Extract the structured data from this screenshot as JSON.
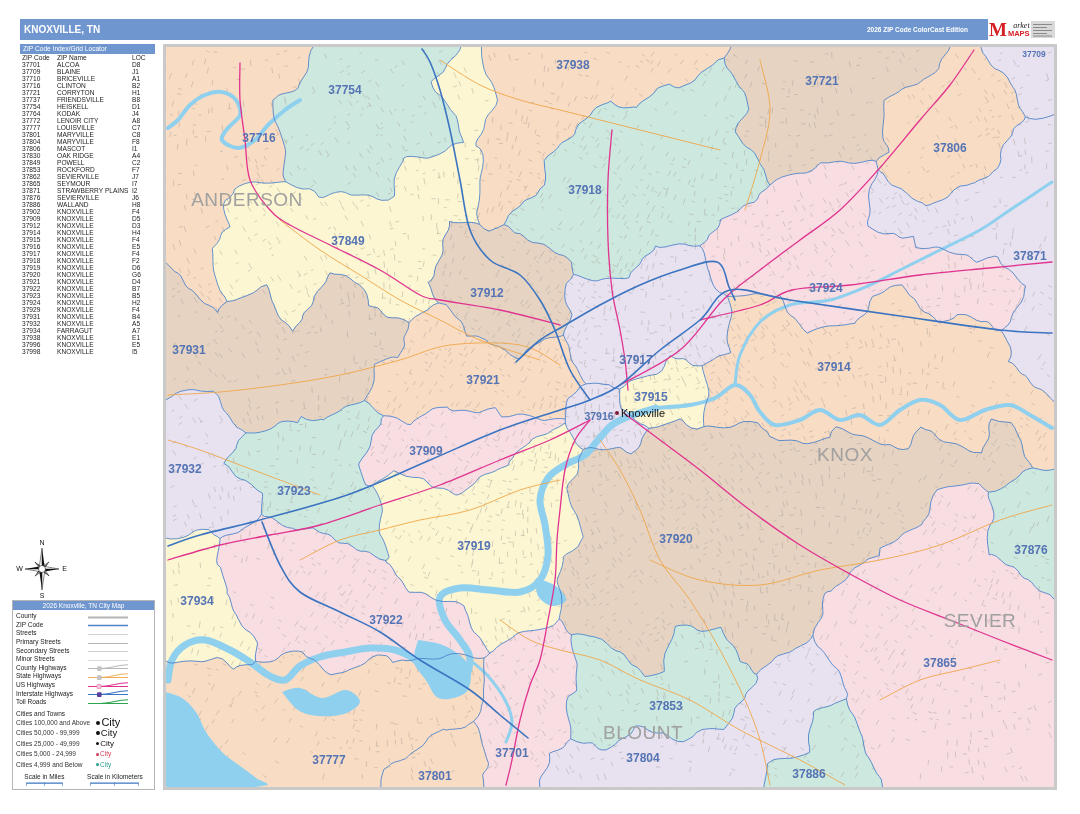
{
  "header": {
    "title": "KNOXVILLE, TN",
    "edition": "2026 ZIP Code ColorCast Edition",
    "logo": {
      "initial": "M",
      "word": "arket",
      "subtitle": "MAPS"
    }
  },
  "index": {
    "title": "ZIP Code Index/Grid Locator",
    "columns": [
      "ZIP Code",
      "ZIP Name",
      "LOC"
    ],
    "rows": [
      {
        "zip": "37701",
        "name": "ALCOA",
        "loc": "D8"
      },
      {
        "zip": "37709",
        "name": "BLAINE",
        "loc": "J1"
      },
      {
        "zip": "37710",
        "name": "BRICEVILLE",
        "loc": "A1"
      },
      {
        "zip": "37716",
        "name": "CLINTON",
        "loc": "B2"
      },
      {
        "zip": "37721",
        "name": "CORRYTON",
        "loc": "H1"
      },
      {
        "zip": "37737",
        "name": "FRIENDSVILLE",
        "loc": "B8"
      },
      {
        "zip": "37754",
        "name": "HEISKELL",
        "loc": "D1"
      },
      {
        "zip": "37764",
        "name": "KODAK",
        "loc": "J4"
      },
      {
        "zip": "37772",
        "name": "LENOIR CITY",
        "loc": "A8"
      },
      {
        "zip": "37777",
        "name": "LOUISVILLE",
        "loc": "C7"
      },
      {
        "zip": "37801",
        "name": "MARYVILLE",
        "loc": "C8"
      },
      {
        "zip": "37804",
        "name": "MARYVILLE",
        "loc": "F8"
      },
      {
        "zip": "37806",
        "name": "MASCOT",
        "loc": "I1"
      },
      {
        "zip": "37830",
        "name": "OAK RIDGE",
        "loc": "A4"
      },
      {
        "zip": "37849",
        "name": "POWELL",
        "loc": "C2"
      },
      {
        "zip": "37853",
        "name": "ROCKFORD",
        "loc": "F7"
      },
      {
        "zip": "37862",
        "name": "SEVIERVILLE",
        "loc": "J7"
      },
      {
        "zip": "37865",
        "name": "SEYMOUR",
        "loc": "I7"
      },
      {
        "zip": "37871",
        "name": "STRAWBERRY PLAINS",
        "loc": "I2"
      },
      {
        "zip": "37876",
        "name": "SEVIERVILLE",
        "loc": "J6"
      },
      {
        "zip": "37886",
        "name": "WALLAND",
        "loc": "H8"
      },
      {
        "zip": "37902",
        "name": "KNOXVILLE",
        "loc": "F4"
      },
      {
        "zip": "37909",
        "name": "KNOXVILLE",
        "loc": "D5"
      },
      {
        "zip": "37912",
        "name": "KNOXVILLE",
        "loc": "D3"
      },
      {
        "zip": "37914",
        "name": "KNOXVILLE",
        "loc": "H4"
      },
      {
        "zip": "37915",
        "name": "KNOXVILLE",
        "loc": "F4"
      },
      {
        "zip": "37916",
        "name": "KNOXVILLE",
        "loc": "E5"
      },
      {
        "zip": "37917",
        "name": "KNOXVILLE",
        "loc": "F4"
      },
      {
        "zip": "37918",
        "name": "KNOXVILLE",
        "loc": "F2"
      },
      {
        "zip": "37919",
        "name": "KNOXVILLE",
        "loc": "D6"
      },
      {
        "zip": "37920",
        "name": "KNOXVILLE",
        "loc": "G6"
      },
      {
        "zip": "37921",
        "name": "KNOXVILLE",
        "loc": "D4"
      },
      {
        "zip": "37922",
        "name": "KNOXVILLE",
        "loc": "B7"
      },
      {
        "zip": "37923",
        "name": "KNOXVILLE",
        "loc": "B5"
      },
      {
        "zip": "37924",
        "name": "KNOXVILLE",
        "loc": "H2"
      },
      {
        "zip": "37929",
        "name": "KNOXVILLE",
        "loc": "F4"
      },
      {
        "zip": "37931",
        "name": "KNOXVILLE",
        "loc": "B4"
      },
      {
        "zip": "37932",
        "name": "KNOXVILLE",
        "loc": "A5"
      },
      {
        "zip": "37934",
        "name": "FARRAGUT",
        "loc": "A7"
      },
      {
        "zip": "37938",
        "name": "KNOXVILLE",
        "loc": "E1"
      },
      {
        "zip": "37996",
        "name": "KNOXVILLE",
        "loc": "E5"
      },
      {
        "zip": "37998",
        "name": "KNOXVILLE",
        "loc": "I5"
      }
    ]
  },
  "compass": {
    "north": "N",
    "west": "W",
    "east": "E",
    "south": "S"
  },
  "legend": {
    "title": "2026 Knoxville, TN City Map",
    "lines": [
      {
        "label": "County",
        "kind": "county"
      },
      {
        "label": "ZIP Code",
        "kind": "zip"
      },
      {
        "label": "Streets",
        "kind": "streets"
      },
      {
        "label": "Primary Streets",
        "kind": "primary"
      },
      {
        "label": "Secondary Streets",
        "kind": "secondary"
      },
      {
        "label": "Minor Streets",
        "kind": "minor"
      },
      {
        "label": "County Highways",
        "kind": "county_highway"
      },
      {
        "label": "State Highways",
        "kind": "state_highway"
      },
      {
        "label": "US Highways",
        "kind": "us_highway"
      },
      {
        "label": "Interstate Highways",
        "kind": "interstate"
      },
      {
        "label": "Toll Roads",
        "kind": "toll"
      }
    ],
    "cities_title": "Cities and Towns",
    "cities": [
      {
        "label": "Cities 100,000 and Above",
        "sample": "City",
        "kind": "large"
      },
      {
        "label": "Cities 50,000 - 99,999",
        "sample": "City",
        "kind": "medium"
      },
      {
        "label": "Cities 25,000 - 49,999",
        "sample": "City",
        "kind": "small"
      },
      {
        "label": "Cities 5,000 - 24,999",
        "sample": "City",
        "kind": "town"
      },
      {
        "label": "Cities 4,999 and Below",
        "sample": "City",
        "kind": "village"
      }
    ],
    "scales": [
      {
        "label": "Scale in Miles",
        "kind": "miles"
      },
      {
        "label": "Scale in Kilometers",
        "kind": "kilometers"
      }
    ]
  },
  "map": {
    "zones": [
      {
        "zip": "37709",
        "color": "#e7e1f0"
      },
      {
        "zip": "37938",
        "color": "#f9dcc4"
      },
      {
        "zip": "37721",
        "color": "#e6d3c2"
      },
      {
        "zip": "37754",
        "color": "#cde8de"
      },
      {
        "zip": "37716",
        "color": "#f9dcc4"
      },
      {
        "zip": "37806",
        "color": "#f9dcc4"
      },
      {
        "zip": "37918",
        "color": "#cde8de"
      },
      {
        "zip": "37849",
        "color": "#fdf6d2"
      },
      {
        "zip": "37871",
        "color": "#e7e1f0"
      },
      {
        "zip": "37924",
        "color": "#f8dde2"
      },
      {
        "zip": "37912",
        "color": "#e6d3c2"
      },
      {
        "zip": "37931",
        "color": "#e6d3c2"
      },
      {
        "zip": "37917",
        "color": "#e7e1f0"
      },
      {
        "zip": "37914",
        "color": "#f9dcc4"
      },
      {
        "zip": "37921",
        "color": "#f9dcc4"
      },
      {
        "zip": "37915",
        "color": "#fdf6d2"
      },
      {
        "zip": "37916",
        "color": "#e7e1f0"
      },
      {
        "zip": "37909",
        "color": "#f8dde2"
      },
      {
        "zip": "37932",
        "color": "#e7e1f0"
      },
      {
        "zip": "37923",
        "color": "#cde8de"
      },
      {
        "zip": "37920",
        "color": "#e6d3c2"
      },
      {
        "zip": "37919",
        "color": "#fdf6d2"
      },
      {
        "zip": "37876",
        "color": "#cde8de"
      },
      {
        "zip": "37934",
        "color": "#fdf6d2"
      },
      {
        "zip": "37922",
        "color": "#f8dde2"
      },
      {
        "zip": "37865",
        "color": "#f8dde2"
      },
      {
        "zip": "37853",
        "color": "#cde8de"
      },
      {
        "zip": "37804",
        "color": "#e7e1f0"
      },
      {
        "zip": "37701",
        "color": "#f8dde2"
      },
      {
        "zip": "37777",
        "color": "#f9dcc4"
      },
      {
        "zip": "37801",
        "color": "#f9dcc4"
      },
      {
        "zip": "37886",
        "color": "#cde8de"
      }
    ],
    "counties": [
      {
        "name": "ANDERSON"
      },
      {
        "name": "KNOX"
      },
      {
        "name": "SEVIER"
      },
      {
        "name": "BLOUNT"
      }
    ],
    "city": {
      "name": "Knoxville"
    }
  }
}
